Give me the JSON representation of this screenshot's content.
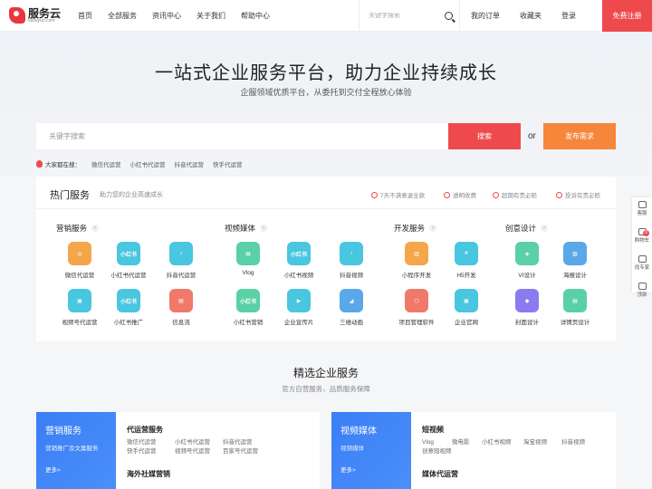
{
  "nav": {
    "logo_name": "服务云",
    "logo_sub": "fuwuyun.com",
    "links": [
      "首页",
      "全部服务",
      "资讯中心",
      "关于我们",
      "帮助中心"
    ],
    "search_placeholder": "关键字搜索",
    "right_links": [
      "我的订单",
      "收藏夹",
      "登录"
    ],
    "register": "免费注册"
  },
  "hero": {
    "title": "一站式企业服务平台，助力企业持续成长",
    "subtitle": "企服领域优质平台，从委托到交付全程放心体验",
    "search_placeholder": "关键字搜索",
    "search_button": "搜索",
    "or": "or",
    "publish_button": "发布需求",
    "hot_label": "大家都在搜：",
    "hot_tags": [
      "微信代运营",
      "小红书代运营",
      "抖音代运营",
      "快手代运营"
    ]
  },
  "hot": {
    "title": "热门服务",
    "desc": "助力您的企业高速成长",
    "guarantees": [
      "7天不满意退全款",
      "透明收费",
      "超期有责必赔",
      "投诉有责必赔"
    ],
    "categories": [
      {
        "title": "营销服务",
        "items": [
          {
            "name": "微信代运营",
            "icon": "wechat-ops-icon",
            "color": "#f6a64a",
            "glyph": "◎"
          },
          {
            "name": "小红书代运营",
            "icon": "xiaohongshu-icon",
            "color": "#49c6e0",
            "glyph": "小红书"
          },
          {
            "name": "抖音代运营",
            "icon": "douyin-icon",
            "color": "#49c6e0",
            "glyph": "♪"
          },
          {
            "name": "视频号代运营",
            "icon": "video-account-icon",
            "color": "#49c6e0",
            "glyph": "▣"
          },
          {
            "name": "小红书推广",
            "icon": "xiaohongshu-promo-icon",
            "color": "#49c6e0",
            "glyph": "小红书"
          },
          {
            "name": "信息流",
            "icon": "feed-icon",
            "color": "#f07a6a",
            "glyph": "▤"
          }
        ]
      },
      {
        "title": "视频媒体",
        "items": [
          {
            "name": "Vlog",
            "icon": "vlog-icon",
            "color": "#5ad0a6",
            "glyph": "▤"
          },
          {
            "name": "小红书视频",
            "icon": "xiaohongshu-video-icon",
            "color": "#49c6e0",
            "glyph": "小红书"
          },
          {
            "name": "抖音视频",
            "icon": "douyin-video-icon",
            "color": "#49c6e0",
            "glyph": "♪"
          },
          {
            "name": "小红书营销",
            "icon": "xiaohongshu-marketing-icon",
            "color": "#5ad0a6",
            "glyph": "小红书"
          },
          {
            "name": "企业宣传片",
            "icon": "promo-film-icon",
            "color": "#49c6e0",
            "glyph": "▶"
          },
          {
            "name": "三维动画",
            "icon": "3d-animation-icon",
            "color": "#5aa8e8",
            "glyph": "◢"
          }
        ]
      },
      {
        "title": "开发服务",
        "items": [
          {
            "name": "小程序开发",
            "icon": "miniprogram-icon",
            "color": "#f6a64a",
            "glyph": "▥"
          },
          {
            "name": "H5开发",
            "icon": "h5-icon",
            "color": "#49c6e0",
            "glyph": "≠"
          },
          {
            "name": "项目管理软件",
            "icon": "project-mgmt-icon",
            "color": "#f07a6a",
            "glyph": "⬡"
          },
          {
            "name": "企业官网",
            "icon": "website-icon",
            "color": "#49c6e0",
            "glyph": "▣"
          }
        ]
      },
      {
        "title": "创意设计",
        "items": [
          {
            "name": "VI设计",
            "icon": "vi-design-icon",
            "color": "#5ad0a6",
            "glyph": "◈"
          },
          {
            "name": "海报设计",
            "icon": "poster-icon",
            "color": "#5aa8e8",
            "glyph": "▨"
          },
          {
            "name": "封面设计",
            "icon": "cover-icon",
            "color": "#8a7cf0",
            "glyph": "◆"
          },
          {
            "name": "详情页设计",
            "icon": "detail-page-icon",
            "color": "#5ad0a6",
            "glyph": "▤"
          }
        ]
      }
    ]
  },
  "side_tools": [
    {
      "label": "客服",
      "icon": "customer-service-icon"
    },
    {
      "label": "购物车",
      "icon": "cart-icon",
      "badge": "0"
    },
    {
      "label": "找专家",
      "icon": "expert-icon"
    },
    {
      "label": "顶部",
      "icon": "top-icon"
    }
  ],
  "selected": {
    "title": "精选企业服务",
    "subtitle": "官方自营服务，品质服务保障",
    "cards": [
      {
        "title": "营销服务",
        "sub": "营销推广及文案服务",
        "more": "更多>",
        "groups": [
          {
            "title": "代运营服务",
            "items": [
              "微信代运营",
              "小红书代运营",
              "抖音代运营",
              "快手代运营",
              "视频号代运营",
              "百家号代运营"
            ]
          },
          {
            "title": "海外社媒营销",
            "items": []
          }
        ]
      },
      {
        "title": "视频媒体",
        "sub": "视频媒体",
        "more": "更多>",
        "groups": [
          {
            "title": "短视频",
            "items": [
              "Vlog",
              "微电影",
              "小红书视频",
              "淘宝视频",
              "抖音视频",
              "创意短视频"
            ]
          },
          {
            "title": "媒体代运营",
            "items": []
          }
        ]
      }
    ]
  }
}
